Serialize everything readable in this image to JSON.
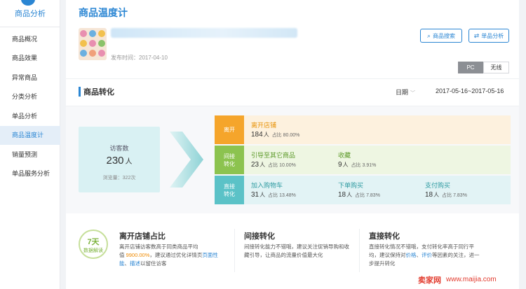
{
  "sidebar": {
    "title": "商品分析",
    "items": [
      {
        "label": "商品概况"
      },
      {
        "label": "商品效果"
      },
      {
        "label": "异常商品"
      },
      {
        "label": "分类分析"
      },
      {
        "label": "单品分析"
      },
      {
        "label": "商品温度计",
        "active": true
      },
      {
        "label": "销量预测"
      },
      {
        "label": "单品服务分析"
      }
    ]
  },
  "header": {
    "title": "商品温度计",
    "publish_time": "发布时间：2017-04-10",
    "product_search": "商品搜索",
    "item_analysis": "单品分析",
    "device_tabs": [
      "PC",
      "无线"
    ],
    "active_device": "PC"
  },
  "section": {
    "title": "商品转化",
    "date_select": "日期",
    "date_range": "2017-05-16~2017-05-16"
  },
  "flow": {
    "visitors_label": "访客数",
    "visitors": "230",
    "visitors_unit": "人",
    "pageviews": "浏览量：322次",
    "rows": [
      {
        "label": "离开",
        "color": "#f5a52b",
        "bg": "#fdf1de",
        "cells": [
          {
            "title": "离开店铺",
            "value": "184",
            "unit": "人",
            "pct": "占比 80.00%"
          }
        ]
      },
      {
        "label": "间接转化",
        "color": "#8cc34f",
        "bg": "#eef6e2",
        "cells": [
          {
            "title": "引导至其它商品",
            "value": "23",
            "unit": "人",
            "pct": "占比 10.00%"
          },
          {
            "title": "收藏",
            "value": "9",
            "unit": "人",
            "pct": "占比 3.91%"
          }
        ]
      },
      {
        "label": "直接转化",
        "color": "#5bc2c7",
        "bg": "#e2f3f5",
        "cells": [
          {
            "title": "加入购物车",
            "value": "31",
            "unit": "人",
            "pct": "占比 13.48%"
          },
          {
            "title": "下单购买",
            "value": "18",
            "unit": "人",
            "pct": "占比 7.83%"
          },
          {
            "title": "支付购买",
            "value": "18",
            "unit": "人",
            "pct": "占比 7.83%"
          }
        ]
      }
    ]
  },
  "tips": {
    "badge_num": "7天",
    "badge_text": "数据解读",
    "card1": {
      "title": "离开店铺占比",
      "desc_a": "离开店铺访客数高于同类商品平均",
      "desc_b": "值",
      "desc_hl": "9900.00%",
      "desc_c": "，建议通过优化详情页",
      "desc_lk1": "页面性",
      "desc_lk2": "能",
      "desc_d": "、",
      "desc_lk3": "描述",
      "desc_e": "以留住访客"
    },
    "card2": {
      "title": "间接转化",
      "desc": "间接转化能力不错哦，建议关注促销导购和收藏引导，让商品的流量价值最大化"
    },
    "card3": {
      "title": "直接转化",
      "desc_a": "直接转化情况不错哦，支付转化率高于同行平均",
      "desc_b": "，建议保持对",
      "desc_lk1": "价格",
      "desc_c": "、",
      "desc_lk2": "评价",
      "desc_d": "等因素的关注，进一步提升转化"
    }
  },
  "watermark": {
    "logo": "卖家网",
    "url": "www.maijia.com"
  }
}
